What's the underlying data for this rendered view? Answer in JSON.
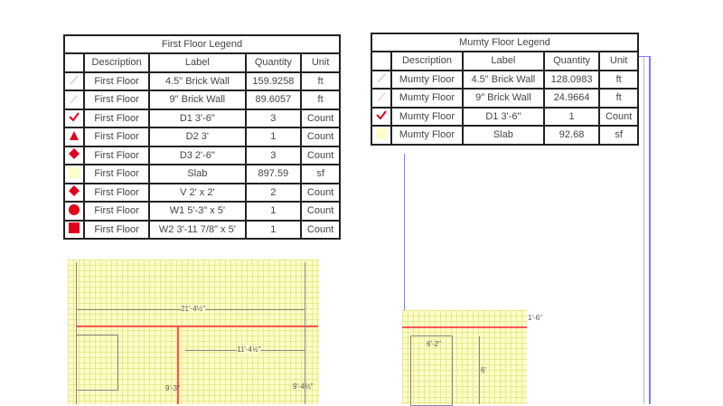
{
  "first_floor_legend": {
    "title": "First Floor Legend",
    "headers": [
      "Description",
      "Label",
      "Quantity",
      "Unit"
    ],
    "rows": [
      {
        "icon": "wall-line-gray",
        "description": "First Floor",
        "label": "4.5\" Brick Wall",
        "quantity": "159.9258",
        "unit": "ft"
      },
      {
        "icon": "wall-line-pink",
        "description": "First Floor",
        "label": "9\" Brick Wall",
        "quantity": "89.6057",
        "unit": "ft"
      },
      {
        "icon": "checkmark",
        "description": "First Floor",
        "label": "D1 3'-6\"",
        "quantity": "3",
        "unit": "Count"
      },
      {
        "icon": "triangle",
        "description": "First Floor",
        "label": "D2 3'",
        "quantity": "1",
        "unit": "Count"
      },
      {
        "icon": "diamond",
        "description": "First Floor",
        "label": "D3 2'-6\"",
        "quantity": "3",
        "unit": "Count"
      },
      {
        "icon": "slab",
        "description": "First Floor",
        "label": "Slab",
        "quantity": "897.59",
        "unit": "sf"
      },
      {
        "icon": "diamond",
        "description": "First Floor",
        "label": "V 2' x 2'",
        "quantity": "2",
        "unit": "Count"
      },
      {
        "icon": "circle",
        "description": "First Floor",
        "label": "W1 5'-3\" x 5'",
        "quantity": "1",
        "unit": "Count"
      },
      {
        "icon": "square",
        "description": "First Floor",
        "label": "W2 3'-11 7/8\" x 5'",
        "quantity": "1",
        "unit": "Count"
      }
    ]
  },
  "mumty_floor_legend": {
    "title": "Mumty Floor Legend",
    "headers": [
      "Description",
      "Label",
      "Quantity",
      "Unit"
    ],
    "rows": [
      {
        "icon": "wall-line-gray",
        "description": "Mumty Floor",
        "label": "4.5\" Brick Wall",
        "quantity": "128.0983",
        "unit": "ft"
      },
      {
        "icon": "wall-line-pink",
        "description": "Mumty Floor",
        "label": "9\" Brick Wall",
        "quantity": "24.9664",
        "unit": "ft"
      },
      {
        "icon": "checkmark",
        "description": "Mumty Floor",
        "label": "D1 3'-6\"",
        "quantity": "1",
        "unit": "Count"
      },
      {
        "icon": "slab",
        "description": "Mumty Floor",
        "label": "Slab",
        "quantity": "92.68",
        "unit": "sf"
      }
    ]
  },
  "dimensions": {
    "d1": "21'-4½\"",
    "d2": "11'-4½\"",
    "d3": "9'-3\"",
    "d4": "9'-4½\"",
    "d5": "1'-6\"",
    "d6": "6'-2\"",
    "d7": "6'"
  },
  "colors": {
    "accent": "#e0001a",
    "slab": "#fdfdc8",
    "border": "#7b7bff"
  }
}
